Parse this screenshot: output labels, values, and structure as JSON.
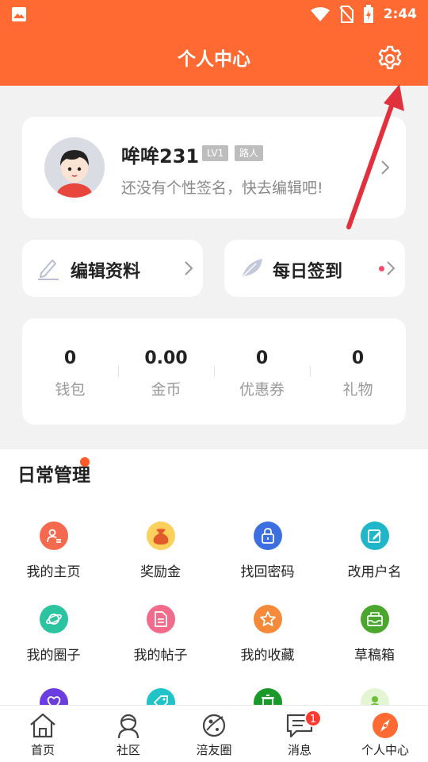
{
  "status_bar": {
    "time": "2:44"
  },
  "header": {
    "title": "个人中心"
  },
  "profile": {
    "name": "哞哞231",
    "level": "LV1",
    "role": "路人",
    "signature": "还没有个性签名，快去编辑吧!"
  },
  "actions": {
    "edit_label": "编辑资料",
    "sign_label": "每日签到"
  },
  "stats": [
    {
      "value": "0",
      "label": "钱包"
    },
    {
      "value": "0.00",
      "label": "金币"
    },
    {
      "value": "0",
      "label": "优惠券"
    },
    {
      "value": "0",
      "label": "礼物"
    }
  ],
  "daily": {
    "title": "日常管理",
    "items": [
      {
        "label": "我的主页",
        "icon": "user-page-icon",
        "color": "#f56a4f"
      },
      {
        "label": "奖励金",
        "icon": "money-bag-icon",
        "color": "#f7b22a"
      },
      {
        "label": "找回密码",
        "icon": "lock-icon",
        "color": "#3d6fe0"
      },
      {
        "label": "改用户名",
        "icon": "edit-note-icon",
        "color": "#1fb6c9"
      },
      {
        "label": "我的圈子",
        "icon": "planet-icon",
        "color": "#2cc3a0"
      },
      {
        "label": "我的帖子",
        "icon": "document-icon",
        "color": "#f26b8a"
      },
      {
        "label": "我的收藏",
        "icon": "star-icon",
        "color": "#f58a3a"
      },
      {
        "label": "草稿箱",
        "icon": "inbox-icon",
        "color": "#4aa62c"
      },
      {
        "label": "",
        "icon": "heart-icon",
        "color": "#6a3de0"
      },
      {
        "label": "",
        "icon": "tag-icon",
        "color": "#20c3c8"
      },
      {
        "label": "",
        "icon": "trash-icon",
        "color": "#1a9a2a"
      },
      {
        "label": "",
        "icon": "person-icon",
        "color": "#9fd86a"
      }
    ]
  },
  "nav": [
    {
      "label": "首页",
      "icon": "home-icon"
    },
    {
      "label": "社区",
      "icon": "community-icon"
    },
    {
      "label": "涪友圈",
      "icon": "planet-nav-icon"
    },
    {
      "label": "消息",
      "icon": "message-icon",
      "badge": "1"
    },
    {
      "label": "个人中心",
      "icon": "compass-icon"
    }
  ],
  "colors": {
    "brand": "#ff6a33",
    "annotation": "#e0313c"
  }
}
